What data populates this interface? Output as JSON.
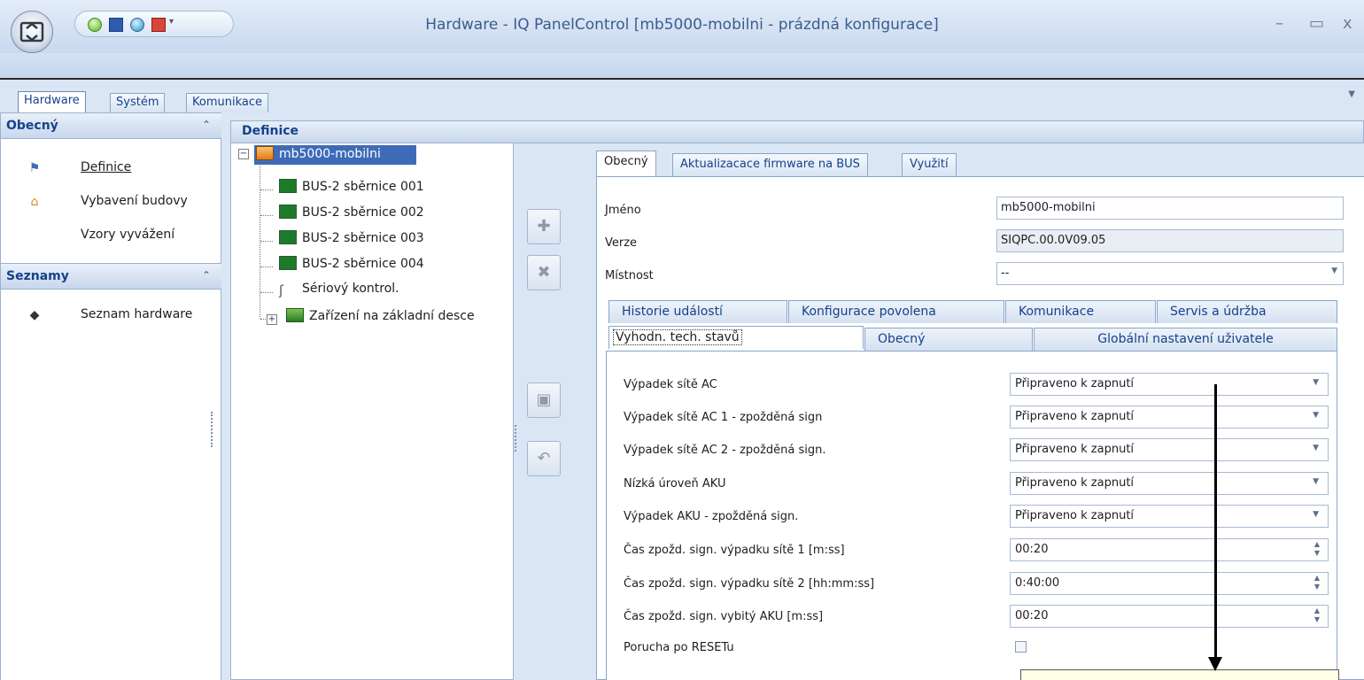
{
  "window": {
    "title": "Hardware - IQ PanelControl [mb5000-mobilni - prázdná konfigurace]",
    "minimize": "–",
    "maximize": "▭",
    "close": "x"
  },
  "quick_access": {
    "icons": [
      "status-green-icon",
      "save-icon",
      "globe-icon",
      "red-tool-icon"
    ],
    "dropdown": "▾"
  },
  "top_tabs": [
    {
      "label": "Hardware",
      "active": true
    },
    {
      "label": "Systém",
      "active": false
    },
    {
      "label": "Komunikace",
      "active": false
    }
  ],
  "nav": {
    "sections": [
      {
        "title": "Obecný",
        "chevron": "≈",
        "items": [
          {
            "label": "Definice",
            "icon": "definition-icon"
          },
          {
            "label": "Vybavení budovy",
            "icon": "building-icon"
          },
          {
            "label": "Vzory vyvážení",
            "icon": ""
          }
        ]
      },
      {
        "title": "Seznamy",
        "chevron": "≈",
        "items": [
          {
            "label": "Seznam hardware",
            "icon": "hardware-list-icon"
          }
        ]
      }
    ]
  },
  "definice": {
    "title": "Definice",
    "tree": {
      "root": "mb5000-mobilni",
      "children": [
        "BUS-2 sběrnice 001",
        "BUS-2 sběrnice 002",
        "BUS-2 sběrnice 003",
        "BUS-2 sběrnice 004",
        "Sériový kontrol.",
        "Zařízení na základní desce"
      ]
    }
  },
  "detail": {
    "tabs": [
      "Obecný",
      "Aktualizacace firmware na BUS",
      "Využití"
    ],
    "fields": {
      "name_label": "Jméno",
      "name_value": "mb5000-mobilni",
      "version_label": "Verze",
      "version_value": "SIQPC.00.0V09.05",
      "room_label": "Místnost",
      "room_value": "--"
    },
    "inner_tabs_row1": [
      "Historie událostí",
      "Konfigurace povolena",
      "Komunikace",
      "Servis a údržba"
    ],
    "inner_tabs_row2": [
      "Vyhodn. tech. stavů",
      "Obecný",
      "Globální nastavení uživatele"
    ],
    "settings": [
      {
        "label": "Výpadek sítě AC",
        "value": "Připraveno k zapnutí"
      },
      {
        "label": "Výpadek sítě AC 1 - zpožděná sign",
        "value": "Připraveno k zapnutí"
      },
      {
        "label": "Výpadek sítě AC 2 - zpožděná sign.",
        "value": "Připraveno k zapnutí"
      },
      {
        "label": "Nízká úroveň AKU",
        "value": "Připraveno k zapnutí"
      },
      {
        "label": "Výpadek AKU  - zpožděná sign.",
        "value": "Připraveno k zapnutí"
      },
      {
        "label": "Čas zpožd. sign. výpadku sítě 1 [m:ss]",
        "value": "00:20"
      },
      {
        "label": "Čas zpožd. sign. výpadku sítě 2 [hh:mm:ss]",
        "value": "0:40:00"
      },
      {
        "label": "Čas zpožd. sign. vybitý AKU [m:ss]",
        "value": "00:20"
      },
      {
        "label": "Porucha po RESETu",
        "value": ""
      }
    ]
  },
  "colors": {
    "accent": "#15428b",
    "selection": "#3d6bb8",
    "frame": "#dbe6f4"
  }
}
